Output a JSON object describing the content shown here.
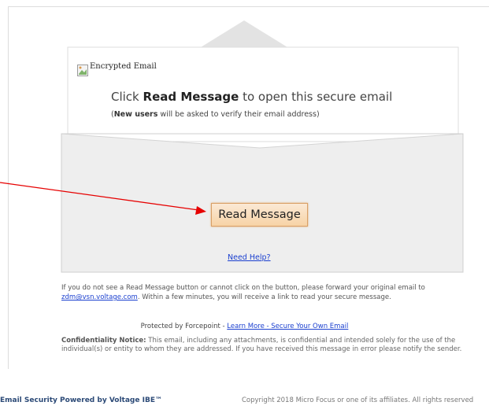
{
  "brand": {
    "logo_alt": "Encrypted Email",
    "logo_overlay": "Forcepoint"
  },
  "message": {
    "headline_prefix": "Click ",
    "headline_bold": "Read Message",
    "headline_suffix": " to open this secure email",
    "sub_open": "(",
    "sub_bold": "New users",
    "sub_rest": " will be asked to verify their email address)"
  },
  "actions": {
    "read_message": "Read Message",
    "need_help": "Need Help?"
  },
  "info": {
    "text_before": "If you do not see a Read Message button or cannot click on the button, please forward your original email to ",
    "email": "zdm@vsn.voltage.com",
    "text_after": ". Within a few minutes, you will receive a link to read your secure message."
  },
  "protected": {
    "prefix": "Protected by Forcepoint - ",
    "link": "Learn More - Secure Your Own Email"
  },
  "confidentiality": {
    "label": "Confidentiality Notice:",
    "text": " This email, including any attachments, is confidential and intended solely for the use of the individual(s) or entity to whom they are addressed. If you have received this message in error please notify the sender."
  },
  "footer": {
    "left": "Email Security Powered by Voltage IBE™",
    "right": "Copyright 2018 Micro Focus or one of its affiliates. All rights reserved"
  },
  "colors": {
    "accent": "#f7d3a6",
    "link": "#1a3fcf",
    "arrow": "#e60000"
  }
}
